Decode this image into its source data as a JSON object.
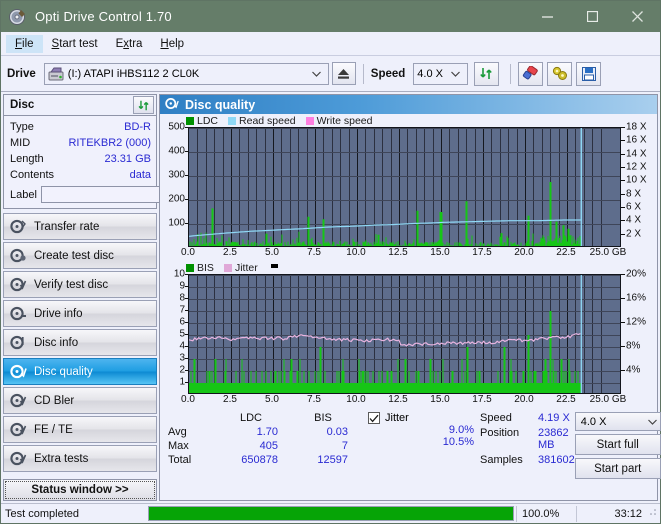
{
  "window": {
    "title": "Opti Drive Control 1.70",
    "icon": "disc-icon",
    "buttons": {
      "minimize": "—",
      "maximize": "□",
      "close": "✕"
    }
  },
  "menu": {
    "items": [
      "File",
      "Start test",
      "Extra",
      "Help"
    ],
    "active": "File"
  },
  "toolbar": {
    "drive_label": "Drive",
    "drive_value": "(I:)  ATAPI iHBS112  2 CL0K",
    "eject_icon": "eject-icon",
    "speed_label": "Speed",
    "speed_value": "4.0 X",
    "refresh_icon": "refresh-icon",
    "erase_icon": "eraser-icon",
    "tools_icon": "tools-icon",
    "save_icon": "save-icon"
  },
  "disc": {
    "panel_title": "Disc",
    "refresh_icon": "refresh-icon",
    "rows": [
      {
        "key": "Type",
        "value": "BD-R"
      },
      {
        "key": "MID",
        "value": "RITEKBR2 (000)"
      },
      {
        "key": "Length",
        "value": "23.31 GB"
      },
      {
        "key": "Contents",
        "value": "data"
      }
    ],
    "label_key": "Label",
    "label_value": "",
    "label_placeholder": "",
    "disc_icon": "cd-icon"
  },
  "nav": {
    "items": [
      {
        "label": "Transfer rate",
        "icon": "disc-arrow-icon",
        "selected": false
      },
      {
        "label": "Create test disc",
        "icon": "disc-write-icon",
        "selected": false
      },
      {
        "label": "Verify test disc",
        "icon": "disc-check-icon",
        "selected": false
      },
      {
        "label": "Drive info",
        "icon": "drive-info-icon",
        "selected": false
      },
      {
        "label": "Disc info",
        "icon": "disc-info-icon",
        "selected": false
      },
      {
        "label": "Disc quality",
        "icon": "disc-quality-icon",
        "selected": true
      },
      {
        "label": "CD Bler",
        "icon": "cd-bler-icon",
        "selected": false
      },
      {
        "label": "FE / TE",
        "icon": "fe-te-icon",
        "selected": false
      },
      {
        "label": "Extra tests",
        "icon": "extra-tests-icon",
        "selected": false
      }
    ],
    "status_window": "Status window >>"
  },
  "main": {
    "header_title": "Disc quality",
    "header_icon": "disc-quality-icon"
  },
  "stats": {
    "col_headers": [
      "",
      "LDC",
      "BIS"
    ],
    "rows": [
      {
        "label": "Avg",
        "ldc": "1.70",
        "bis": "0.03",
        "jitter": "9.0%"
      },
      {
        "label": "Max",
        "ldc": "405",
        "bis": "7",
        "jitter": "10.5%"
      },
      {
        "label": "Total",
        "ldc": "650878",
        "bis": "12597",
        "jitter": ""
      }
    ],
    "jitter_label": "Jitter",
    "jitter_checked": true,
    "speed_label": "Speed",
    "speed_value": "4.19 X",
    "position_label": "Position",
    "position_value": "23862 MB",
    "samples_label": "Samples",
    "samples_value": "381602",
    "speed_select": "4.0 X",
    "start_full": "Start full",
    "start_part": "Start part"
  },
  "statusbar": {
    "message": "Test completed",
    "progress_percent": 100.0,
    "percent_text": "100.0%",
    "elapsed": "33:12"
  },
  "colors": {
    "title_bar": "#657d69",
    "accent_header": "#2f7fc4",
    "ldc_green": "#00b000",
    "read_speed_blue": "#8fd8f5",
    "write_speed_pink": "#ff7fe0",
    "bis_green": "#00c000",
    "jitter_pink": "#e8b4e0",
    "plot_bg": "#5e6d8c",
    "value_blue": "#2a2ad2",
    "progress_green": "#06a406"
  },
  "chart_data": [
    {
      "type": "line",
      "title": "Disc quality - LDC",
      "xlabel": "GB",
      "ylabel": "LDC",
      "xlim": [
        0,
        25
      ],
      "ylim": [
        0,
        500
      ],
      "y2lim": [
        0,
        18
      ],
      "y2label": "X",
      "grid": true,
      "legend": [
        "LDC",
        "Read speed",
        "Write speed"
      ],
      "legend_position": "top-left",
      "xticks": [
        "0.0",
        "2.5",
        "5.0",
        "7.5",
        "10.0",
        "12.5",
        "15.0",
        "17.5",
        "20.0",
        "22.5",
        "25.0"
      ],
      "yticks": [
        100,
        200,
        300,
        400,
        500
      ],
      "y2ticks": [
        "2 X",
        "4 X",
        "6 X",
        "8 X",
        "10 X",
        "12 X",
        "14 X",
        "16 X",
        "18 X"
      ],
      "series": [
        {
          "name": "Read speed",
          "color": "#8fd8f5",
          "x": [
            0.0,
            0.6,
            1.3,
            2.0,
            2.8,
            3.6,
            4.4,
            5.2,
            6.0,
            6.8,
            7.4,
            8.0,
            8.8,
            9.6,
            10.4,
            11.2,
            12.0,
            12.8,
            13.6,
            14.4,
            15.2,
            16.0,
            16.8,
            17.6,
            18.4,
            19.2,
            20.0,
            20.8,
            21.6,
            22.4,
            23.1,
            23.35,
            23.35
          ],
          "y_speed": [
            1.75,
            1.9,
            2.05,
            2.2,
            2.35,
            2.5,
            2.6,
            2.7,
            2.8,
            2.9,
            3.0,
            3.1,
            3.2,
            3.25,
            3.35,
            3.45,
            3.5,
            3.6,
            3.7,
            3.75,
            3.85,
            3.9,
            3.95,
            4.0,
            4.05,
            4.1,
            4.1,
            4.1,
            4.15,
            4.2,
            4.2,
            4.2,
            18.0
          ]
        },
        {
          "name": "LDC",
          "color": "#00b000",
          "note": "Dense error spike bars along full scan, baseline 5-30, peaks at ~1.4GB:165, 7.1GB:130, 8.0GB:120, 13.6GB:155, 15.0GB:150, 16.5GB:195, 20.2GB:135, 21.5GB:275, 22.3GB:95",
          "max": 405,
          "avg": 1.7,
          "total": 650878
        },
        {
          "name": "Write speed",
          "color": "#ff7fe0",
          "x": [],
          "y": []
        }
      ]
    },
    {
      "type": "line",
      "title": "Disc quality - BIS",
      "xlabel": "GB",
      "ylabel": "BIS",
      "xlim": [
        0,
        25
      ],
      "ylim": [
        0,
        10
      ],
      "y2lim": [
        0,
        20
      ],
      "y2label": "%",
      "grid": true,
      "legend": [
        "BIS",
        "Jitter"
      ],
      "legend_position": "top-left",
      "xticks": [
        "0.0",
        "2.5",
        "5.0",
        "7.5",
        "10.0",
        "12.5",
        "15.0",
        "17.5",
        "20.0",
        "22.5",
        "25.0"
      ],
      "yticks": [
        1,
        2,
        3,
        4,
        5,
        6,
        7,
        8,
        9,
        10
      ],
      "y2ticks": [
        "4%",
        "8%",
        "12%",
        "16%",
        "20%"
      ],
      "series": [
        {
          "name": "Jitter",
          "color": "#e8b4e0",
          "x": [
            0.0,
            0.8,
            1.6,
            2.4,
            3.2,
            4.0,
            4.8,
            5.6,
            6.4,
            6.8,
            7.6,
            8.4,
            9.2,
            10.0,
            10.8,
            11.6,
            12.4,
            12.7,
            13.2,
            14.0,
            14.8,
            15.6,
            16.4,
            17.2,
            18.0,
            18.8,
            19.6,
            20.4,
            21.2,
            22.0,
            22.8,
            23.3
          ],
          "y_percent": [
            9.2,
            9.4,
            9.6,
            9.3,
            9.4,
            9.4,
            9.5,
            9.4,
            9.8,
            9.9,
            9.6,
            9.3,
            9.2,
            9.1,
            9.1,
            9.2,
            9.3,
            8.3,
            8.4,
            8.5,
            8.6,
            8.6,
            8.7,
            8.7,
            8.8,
            9.0,
            9.1,
            9.2,
            9.4,
            9.6,
            9.8,
            10.2
          ]
        },
        {
          "name": "BIS",
          "color": "#00c000",
          "note": "Dense bars with baseline ~1, frequent spikes to 2-3, isolated peaks 7.8GB:4, 16.6GB:4, 18.8GB:4, 20.2GB:5, 21.5GB:7",
          "max": 7,
          "avg": 0.03,
          "total": 12597
        }
      ]
    }
  ]
}
